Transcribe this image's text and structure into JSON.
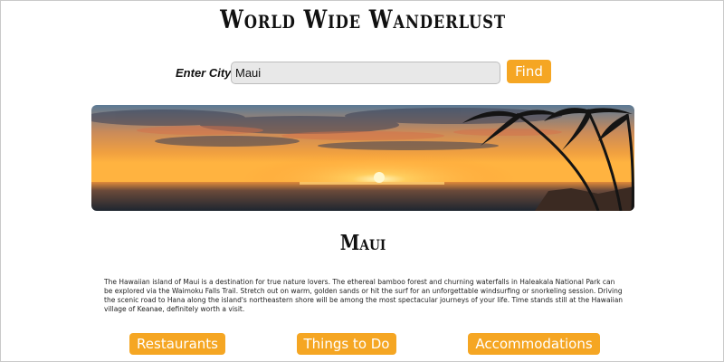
{
  "header": {
    "title": "World Wide Wanderlust"
  },
  "search": {
    "label": "Enter City:",
    "value": "Maui",
    "button": "Find"
  },
  "hero": {
    "alt": "Sunset over the ocean with palm trees"
  },
  "place": {
    "name": "Maui",
    "description": "The Hawaiian island of Maui is a destination for true nature lovers. The ethereal bamboo forest and churning waterfalls in Haleakala National Park can be explored via the Waimoku Falls Trail. Stretch out on warm, golden sands or hit the surf for an unforgettable windsurfing or snorkeling session. Driving the scenic road to Hana along the island's northeastern shore will be among the most spectacular journeys of your life. Time stands still at the Hawaiian village of Keanae, definitely worth a visit."
  },
  "categories": {
    "restaurants": "Restaurants",
    "things_to_do": "Things to Do",
    "accommodations": "Accommodations"
  },
  "colors": {
    "accent": "#f5a623",
    "input_bg": "#e8e8e8"
  }
}
